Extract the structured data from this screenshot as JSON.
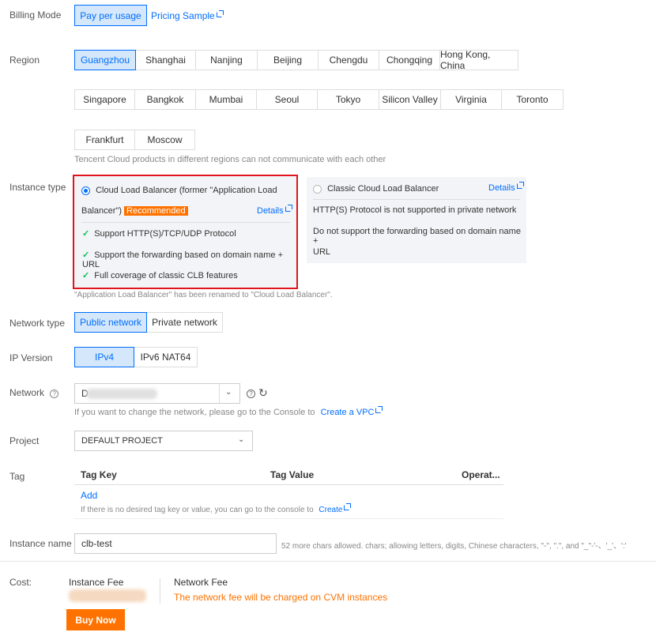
{
  "billing": {
    "label": "Billing Mode",
    "option": "Pay per usage",
    "pricing_link": "Pricing Sample"
  },
  "region": {
    "label": "Region",
    "row1": [
      "Guangzhou",
      "Shanghai",
      "Nanjing",
      "Beijing",
      "Chengdu",
      "Chongqing",
      "Hong Kong, China"
    ],
    "row2": [
      "Singapore",
      "Bangkok",
      "Mumbai",
      "Seoul",
      "Tokyo",
      "Silicon Valley",
      "Virginia",
      "Toronto"
    ],
    "row3": [
      "Frankfurt",
      "Moscow"
    ],
    "selected": "Guangzhou",
    "hint": "Tencent Cloud products in different regions can not communicate with each other"
  },
  "instance_type": {
    "label": "Instance type",
    "clb": {
      "title_line1": "Cloud Load Balancer (former \"Application Load",
      "title_line2": "Balancer\")",
      "badge": "Recommended",
      "details": "Details",
      "features": [
        "Support HTTP(S)/TCP/UDP Protocol",
        "Support the forwarding based on domain name + URL",
        "Full coverage of classic CLB features"
      ]
    },
    "classic": {
      "title": "Classic Cloud Load Balancer",
      "details": "Details",
      "line1": "HTTP(S) Protocol is not supported in private network",
      "line2": "Do not support the forwarding based on domain name +",
      "line3": "URL"
    },
    "note": "\"Application Load Balancer\" has been renamed to \"Cloud Load Balancer\"."
  },
  "network_type": {
    "label": "Network type",
    "options": [
      "Public network",
      "Private network"
    ]
  },
  "ip_version": {
    "label": "IP Version",
    "options": [
      "IPv4",
      "IPv6 NAT64"
    ]
  },
  "network": {
    "label": "Network",
    "value_prefix": "D",
    "hint": "If you want to change the network, please go to the Console to",
    "link": "Create a VPC"
  },
  "project": {
    "label": "Project",
    "value": "DEFAULT PROJECT"
  },
  "tag": {
    "label": "Tag",
    "col_key": "Tag Key",
    "col_value": "Tag Value",
    "col_op": "Operat...",
    "add": "Add",
    "hint": "If there is no desired tag key or value, you can go to the console to",
    "link": "Create"
  },
  "instance_name": {
    "label": "Instance name",
    "value": "clb-test",
    "hint": "52 more chars allowed. chars; allowing letters, digits, Chinese characters, \"-\", \".\", and \"_\"-'-、'_'、':'"
  },
  "cost": {
    "label": "Cost:",
    "instance_fee_label": "Instance Fee",
    "network_fee_label": "Network Fee",
    "network_fee_text": "The network fee will be charged on CVM instances",
    "buy_button": "Buy Now"
  },
  "colors": {
    "accent": "#006eff",
    "selected_bg": "#d5e7fa",
    "orange": "#ff7200",
    "highlight_border": "#e0141e",
    "success": "#0abf5b"
  }
}
